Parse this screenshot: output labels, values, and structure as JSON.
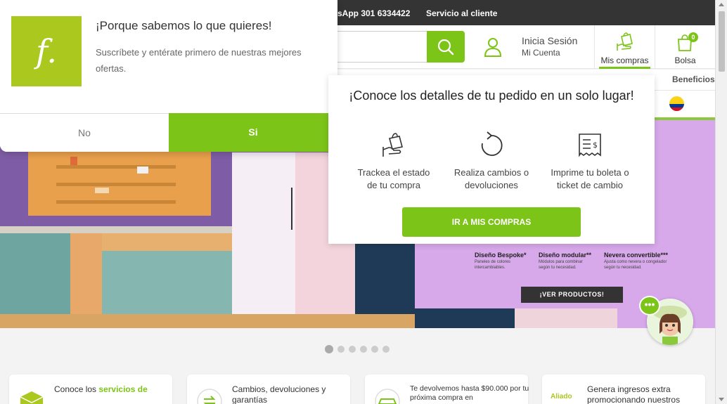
{
  "topbar": {
    "whatsapp": "sApp 301 6334422",
    "customer_service": "Servicio al cliente"
  },
  "header": {
    "search_placeholder": "",
    "login_title": "Inicia Sesión",
    "login_sub": "Mi Cuenta",
    "my_orders": "Mis compras",
    "bag": "Bolsa",
    "bag_count": "0",
    "icons": [
      "search-icon",
      "user-icon",
      "shopping-bag-hand-icon",
      "bag-icon"
    ]
  },
  "nav": {
    "beneficios": "Beneficios"
  },
  "hero": {
    "features": [
      {
        "title": "Diseño Bespoke*",
        "desc": "Paneles de colores intercambiables."
      },
      {
        "title": "Diseño modular**",
        "desc": "Módulos para combinar según tu necesidad."
      },
      {
        "title": "Nevera convertible***",
        "desc": "Ajusta como nevera o congelador según tu necesidad."
      }
    ],
    "cta": "¡VER PRODUCTOS!"
  },
  "carousel": {
    "total": 6,
    "active": 1
  },
  "subscribe_popup": {
    "title": "¡Porque sabemos lo que quieres!",
    "text": "Suscríbete y entérate primero de nuestras mejores ofertas.",
    "no": "No",
    "yes": "Si",
    "logo_letter": "f."
  },
  "order_popup": {
    "title": "¡Conoce los detalles de tu pedido en un solo lugar!",
    "items": [
      {
        "line1": "Trackea el estado",
        "line2": "de tu compra",
        "icon": "hand-bag-icon"
      },
      {
        "line1": "Realiza cambios o",
        "line2": "devoluciones",
        "icon": "return-arrow-icon"
      },
      {
        "line1": "Imprime tu boleta o",
        "line2": "ticket de cambio",
        "icon": "receipt-icon"
      }
    ],
    "button": "IR A MIS COMPRAS"
  },
  "cards": [
    {
      "text": "Conoce los ",
      "highlight": "servicios de",
      "icon": "box-icon"
    },
    {
      "text": "Cambios, devoluciones y garantías",
      "icon": "exchange-icon"
    },
    {
      "text": "Te devolvemos hasta $90.000 por tu próxima compra en",
      "icon": "car-icon"
    },
    {
      "text": "Genera ingresos extra promocionando nuestros",
      "icon": "aliado-icon",
      "logo_text": "Aliado"
    }
  ],
  "colors": {
    "brand_green": "#7cc417",
    "topbar": "#343434",
    "logo_green": "#aac81e"
  }
}
